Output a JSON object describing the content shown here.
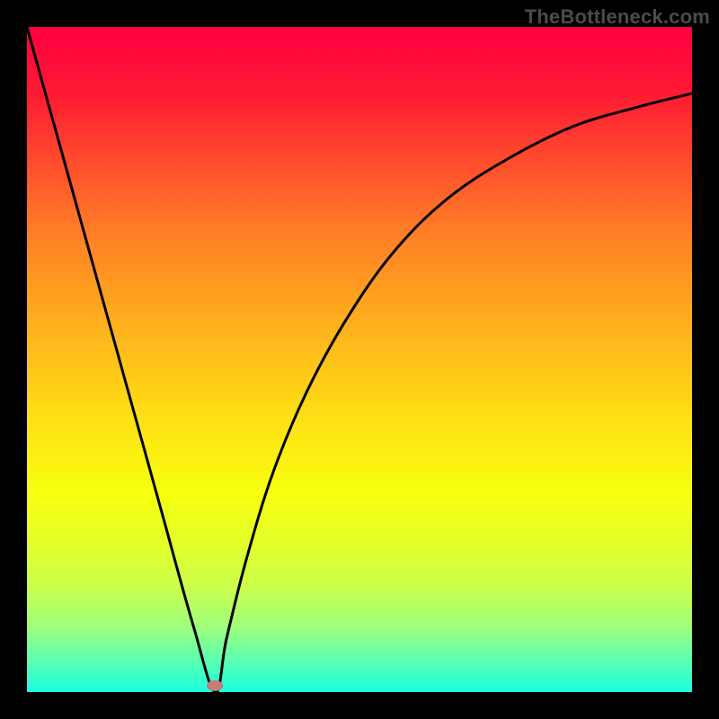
{
  "attribution": "TheBottleneck.com",
  "chart_data": {
    "type": "line",
    "title": "",
    "xlabel": "",
    "ylabel": "",
    "xlim": [
      0,
      1
    ],
    "ylim": [
      0,
      1
    ],
    "series": [
      {
        "name": "curve",
        "x": [
          0.0,
          0.05,
          0.1,
          0.15,
          0.2,
          0.25,
          0.283,
          0.3,
          0.33,
          0.37,
          0.42,
          0.48,
          0.55,
          0.63,
          0.72,
          0.82,
          0.92,
          1.0
        ],
        "values": [
          1.0,
          0.82,
          0.64,
          0.46,
          0.28,
          0.1,
          0.0,
          0.08,
          0.2,
          0.33,
          0.45,
          0.56,
          0.66,
          0.74,
          0.8,
          0.85,
          0.88,
          0.9
        ]
      }
    ],
    "marker": {
      "x": 0.283,
      "y": 0.01
    },
    "background_gradient": {
      "top": "#ff0040",
      "bottom": "#1affe0",
      "stops": [
        "#ff1a33",
        "#ff4b2d",
        "#ff7a26",
        "#ff9f20",
        "#ffc21a",
        "#ffe314",
        "#f7ff0e",
        "#e2ff2a",
        "#ccff4a",
        "#a0ff7a",
        "#5fffae"
      ]
    }
  }
}
